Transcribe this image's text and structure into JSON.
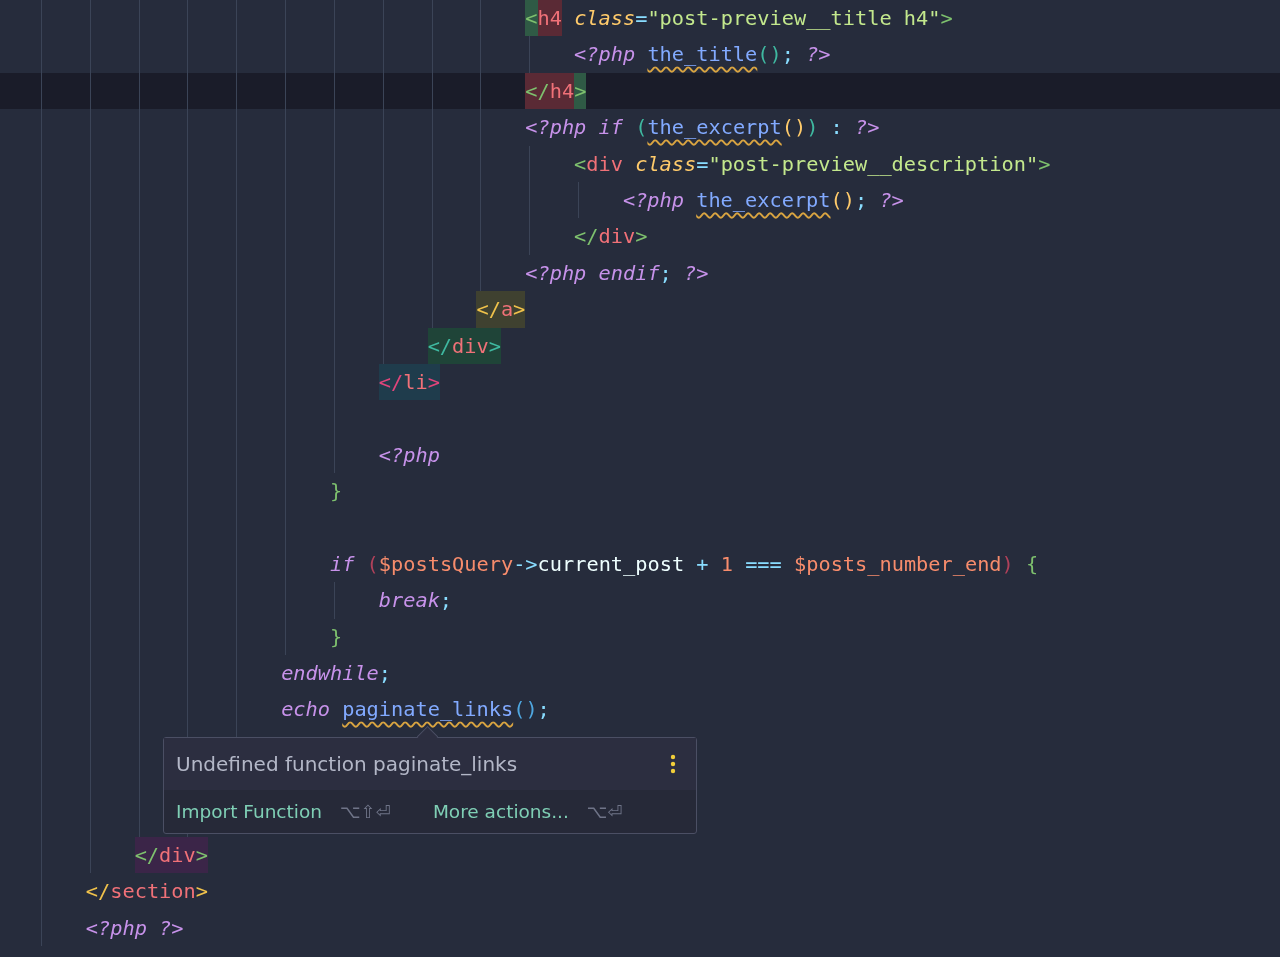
{
  "editor": {
    "lines": [
      {
        "children": [
          {
            "children": [
              {
                "children": [
                  {
                    "children": [
                      {
                        "children": [
                          {
                            "children": [
                              {
                                "children": [
                                  {
                                    "children": [
                                      {
                                        "children": [
                                          {
                                            "children": [
                                              {
                                                "kind": "code",
                                                "current": false,
                                                "tokens": [
                                                  {
                                                    "text": "<",
                                                    "kind": "br-green",
                                                    "color": "#2f5a45"
                                                  },
                                                  {
                                                    "text": "h4",
                                                    "kind": "tag",
                                                    "color": "#5a2a35"
                                                  },
                                                  {
                                                    "text": " class",
                                                    "kind": "attr"
                                                  },
                                                  {
                                                    "text": "=",
                                                    "kind": "punct"
                                                  },
                                                  {
                                                    "text": "\"post-preview__title h4\"",
                                                    "kind": "str"
                                                  },
                                                  {
                                                    "text": ">",
                                                    "kind": "br-green"
                                                  }
                                                ],
                                                "children": [
                                                  {
                                                    "kind": "code",
                                                    "current": false,
                                                    "tokens": [
                                                      {
                                                        "text": "<?php ",
                                                        "kind": "php"
                                                      },
                                                      {
                                                        "text": "the_title",
                                                        "kind": "fn-warn"
                                                      },
                                                      {
                                                        "text": "(",
                                                        "kind": "paren-teal"
                                                      },
                                                      {
                                                        "text": ")",
                                                        "kind": "paren-teal"
                                                      },
                                                      {
                                                        "text": ";",
                                                        "kind": "punct"
                                                      },
                                                      {
                                                        "text": " ?>",
                                                        "kind": "php"
                                                      }
                                                    ]
                                                  }
                                                ]
                                              },
                                              {
                                                "kind": "code",
                                                "current": true,
                                                "tokens": [
                                                  {
                                                    "text": "</",
                                                    "kind": "br-green",
                                                    "color": "#5a2a35"
                                                  },
                                                  {
                                                    "text": "h4",
                                                    "kind": "tag",
                                                    "color": "#5a2a35"
                                                  },
                                                  {
                                                    "text": ">",
                                                    "kind": "br-green",
                                                    "color": "#2f5a45"
                                                  }
                                                ]
                                              },
                                              {
                                                "kind": "code",
                                                "current": false,
                                                "tokens": [
                                                  {
                                                    "text": "<?php if ",
                                                    "kind": "php"
                                                  },
                                                  {
                                                    "text": "(",
                                                    "kind": "paren-teal"
                                                  },
                                                  {
                                                    "text": "the_excerpt",
                                                    "kind": "fn-warn"
                                                  },
                                                  {
                                                    "text": "(",
                                                    "kind": "paren-yellow"
                                                  },
                                                  {
                                                    "text": ")",
                                                    "kind": "paren-yellow"
                                                  },
                                                  {
                                                    "text": ")",
                                                    "kind": "paren-teal"
                                                  },
                                                  {
                                                    "text": " :",
                                                    "kind": "punct"
                                                  },
                                                  {
                                                    "text": " ?>",
                                                    "kind": "php"
                                                  }
                                                ],
                                                "children": [
                                                  {
                                                    "kind": "code",
                                                    "current": false,
                                                    "tokens": [
                                                      {
                                                        "text": "<",
                                                        "kind": "br-green"
                                                      },
                                                      {
                                                        "text": "div",
                                                        "kind": "tag"
                                                      },
                                                      {
                                                        "text": " class",
                                                        "kind": "attr"
                                                      },
                                                      {
                                                        "text": "=",
                                                        "kind": "punct"
                                                      },
                                                      {
                                                        "text": "\"post-preview__description\"",
                                                        "kind": "str"
                                                      },
                                                      {
                                                        "text": ">",
                                                        "kind": "br-green"
                                                      }
                                                    ],
                                                    "children": [
                                                      {
                                                        "kind": "code",
                                                        "current": false,
                                                        "tokens": [
                                                          {
                                                            "text": "<?php ",
                                                            "kind": "php"
                                                          },
                                                          {
                                                            "text": "the_excerpt",
                                                            "kind": "fn-warn"
                                                          },
                                                          {
                                                            "text": "(",
                                                            "kind": "paren-yellow"
                                                          },
                                                          {
                                                            "text": ")",
                                                            "kind": "paren-yellow"
                                                          },
                                                          {
                                                            "text": ";",
                                                            "kind": "punct"
                                                          },
                                                          {
                                                            "text": " ?>",
                                                            "kind": "php"
                                                          }
                                                        ]
                                                      }
                                                    ]
                                                  },
                                                  {
                                                    "kind": "code",
                                                    "current": false,
                                                    "tokens": [
                                                      {
                                                        "text": "</",
                                                        "kind": "br-green"
                                                      },
                                                      {
                                                        "text": "div",
                                                        "kind": "tag"
                                                      },
                                                      {
                                                        "text": ">",
                                                        "kind": "br-green"
                                                      }
                                                    ]
                                                  }
                                                ]
                                              },
                                              {
                                                "kind": "code",
                                                "current": false,
                                                "tokens": [
                                                  {
                                                    "text": "<?php endif",
                                                    "kind": "php"
                                                  },
                                                  {
                                                    "text": ";",
                                                    "kind": "punct"
                                                  },
                                                  {
                                                    "text": " ?>",
                                                    "kind": "php"
                                                  }
                                                ]
                                              }
                                            ]
                                          },
                                          {
                                            "kind": "code",
                                            "current": false,
                                            "tokens": [
                                              {
                                                "text": "</",
                                                "kind": "br-yellow",
                                                "color": "#3f4130"
                                              },
                                              {
                                                "text": "a",
                                                "kind": "tag",
                                                "color": "#3f4130"
                                              },
                                              {
                                                "text": ">",
                                                "kind": "br-yellow",
                                                "color": "#3f4130"
                                              }
                                            ]
                                          }
                                        ]
                                      },
                                      {
                                        "kind": "code",
                                        "current": false,
                                        "tokens": [
                                          {
                                            "text": "</",
                                            "kind": "br-teal",
                                            "color": "#1f4438"
                                          },
                                          {
                                            "text": "div",
                                            "kind": "tag",
                                            "color": "#1f4438"
                                          },
                                          {
                                            "text": ">",
                                            "kind": "br-teal",
                                            "color": "#1f4438"
                                          }
                                        ]
                                      }
                                    ]
                                  },
                                  {
                                    "kind": "code",
                                    "current": false,
                                    "tokens": [
                                      {
                                        "text": "</",
                                        "kind": "br-pink",
                                        "color": "#1f3c4c"
                                      },
                                      {
                                        "text": "li",
                                        "kind": "tag",
                                        "color": "#1f3c4c"
                                      },
                                      {
                                        "text": ">",
                                        "kind": "br-pink",
                                        "color": "#1f3c4c"
                                      }
                                    ]
                                  },
                                  {
                                    "kind": "blank",
                                    "current": false
                                  },
                                  {
                                    "kind": "code",
                                    "current": false,
                                    "tokens": [
                                      {
                                        "text": "<?php",
                                        "kind": "php"
                                      }
                                    ]
                                  }
                                ]
                              },
                              {
                                "kind": "code",
                                "current": false,
                                "tokens": [
                                  {
                                    "text": "}",
                                    "kind": "brace-green"
                                  }
                                ]
                              },
                              {
                                "kind": "blank",
                                "current": false
                              },
                              {
                                "kind": "code",
                                "current": false,
                                "tokens": [
                                  {
                                    "text": "if ",
                                    "kind": "kw"
                                  },
                                  {
                                    "text": "(",
                                    "kind": "paren-red"
                                  },
                                  {
                                    "text": "$postsQuery",
                                    "kind": "var"
                                  },
                                  {
                                    "text": "->",
                                    "kind": "op"
                                  },
                                  {
                                    "text": "current_post",
                                    "kind": "prop"
                                  },
                                  {
                                    "text": " +",
                                    "kind": "op"
                                  },
                                  {
                                    "text": " 1",
                                    "kind": "num"
                                  },
                                  {
                                    "text": " ===",
                                    "kind": "op"
                                  },
                                  {
                                    "text": " $posts_number_end",
                                    "kind": "var"
                                  },
                                  {
                                    "text": ")",
                                    "kind": "paren-red"
                                  },
                                  {
                                    "text": " {",
                                    "kind": "brace-green"
                                  }
                                ],
                                "children": [
                                  {
                                    "kind": "code",
                                    "current": false,
                                    "tokens": [
                                      {
                                        "text": "break",
                                        "kind": "kw"
                                      },
                                      {
                                        "text": ";",
                                        "kind": "punct"
                                      }
                                    ]
                                  }
                                ]
                              },
                              {
                                "kind": "code",
                                "current": false,
                                "tokens": [
                                  {
                                    "text": "}",
                                    "kind": "brace-green"
                                  }
                                ]
                              }
                            ]
                          },
                          {
                            "kind": "code",
                            "current": false,
                            "tokens": [
                              {
                                "text": "endwhile",
                                "kind": "kw"
                              },
                              {
                                "text": ";",
                                "kind": "punct"
                              }
                            ]
                          },
                          {
                            "kind": "code",
                            "current": false,
                            "tokens": [
                              {
                                "text": "echo ",
                                "kind": "kw"
                              },
                              {
                                "text": "paginate_links",
                                "kind": "fn-warn"
                              },
                              {
                                "text": "(",
                                "kind": "paren-blue"
                              },
                              {
                                "text": ")",
                                "kind": "paren-blue"
                              },
                              {
                                "text": ";",
                                "kind": "punct"
                              }
                            ]
                          },
                          {
                            "kind": "blank",
                            "current": false
                          }
                        ]
                      },
                      {
                        "kind": "blank",
                        "current": false
                      },
                      {
                        "kind": "blank",
                        "current": false
                      }
                    ]
                  }
                ]
              },
              {
                "kind": "code",
                "current": false,
                "tokens": [
                  {
                    "text": "</",
                    "kind": "br-green",
                    "color": "#3b2548"
                  },
                  {
                    "text": "div",
                    "kind": "tag",
                    "color": "#3b2548"
                  },
                  {
                    "text": ">",
                    "kind": "br-green",
                    "color": "#3b2548"
                  }
                ]
              }
            ]
          },
          {
            "kind": "code",
            "current": false,
            "tokens": [
              {
                "text": "</",
                "kind": "br-yellow"
              },
              {
                "text": "section",
                "kind": "tag"
              },
              {
                "text": ">",
                "kind": "br-yellow"
              }
            ]
          },
          {
            "kind": "code",
            "current": false,
            "tokens": [
              {
                "text": "<?php ?>",
                "kind": "php"
              }
            ]
          }
        ]
      }
    ]
  },
  "tooltip": {
    "message": "Undefined function paginate_links",
    "actions": [
      {
        "label": "Import Function",
        "shortcut": "⌥⇧⏎"
      },
      {
        "label": "More actions...",
        "shortcut": "⌥⏎"
      }
    ]
  }
}
